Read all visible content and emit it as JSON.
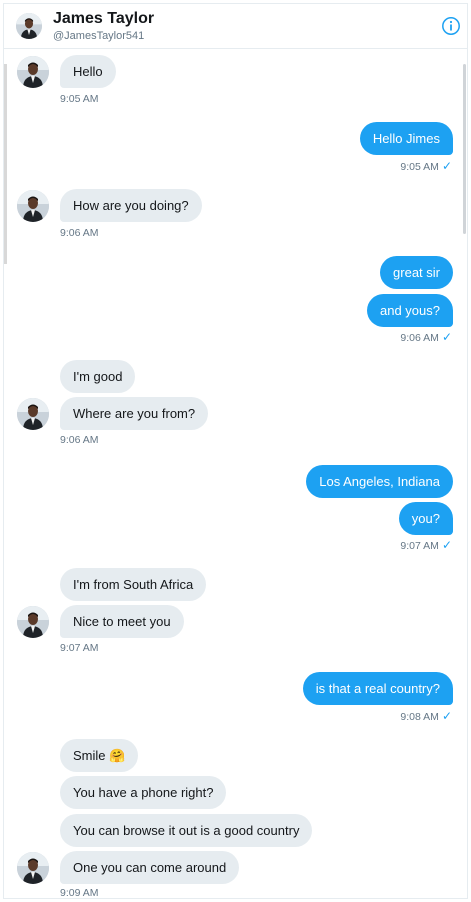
{
  "header": {
    "name": "James Taylor",
    "handle": "@JamesTaylor541",
    "info_icon": "info-icon"
  },
  "colors": {
    "accent": "#1da1f2",
    "incoming_bubble": "#e6ecf0",
    "meta_text": "#657786"
  },
  "messages": [
    {
      "dir": "in",
      "text": "Hello"
    },
    {
      "dir": "in_time",
      "text": "9:05 AM"
    },
    {
      "dir": "out",
      "text": "Hello Jimes"
    },
    {
      "dir": "out_time",
      "text": "9:05 AM"
    },
    {
      "dir": "in",
      "text": "How are you doing?"
    },
    {
      "dir": "in_time",
      "text": "9:06 AM"
    },
    {
      "dir": "out",
      "text": "great sir"
    },
    {
      "dir": "out",
      "text": "and yous?"
    },
    {
      "dir": "out_time",
      "text": "9:06 AM"
    },
    {
      "dir": "in",
      "text": "I'm good"
    },
    {
      "dir": "in",
      "text": "Where are you from?"
    },
    {
      "dir": "in_time",
      "text": "9:06 AM"
    },
    {
      "dir": "out",
      "text": "Los Angeles, Indiana"
    },
    {
      "dir": "out",
      "text": "you?"
    },
    {
      "dir": "out_time",
      "text": "9:07 AM"
    },
    {
      "dir": "in",
      "text": "I'm from South Africa"
    },
    {
      "dir": "in",
      "text": "Nice to meet you"
    },
    {
      "dir": "in_time",
      "text": "9:07 AM"
    },
    {
      "dir": "out",
      "text": "is that a real country?"
    },
    {
      "dir": "out_time",
      "text": "9:08 AM"
    },
    {
      "dir": "in",
      "text": "Smile 🤗"
    },
    {
      "dir": "in",
      "text": "You have a phone right?"
    },
    {
      "dir": "in",
      "text": "You can browse it out is a good country"
    },
    {
      "dir": "in",
      "text": "One you can come around"
    },
    {
      "dir": "in_time",
      "text": "9:09 AM"
    }
  ],
  "read_receipt_icon": "check-icon"
}
